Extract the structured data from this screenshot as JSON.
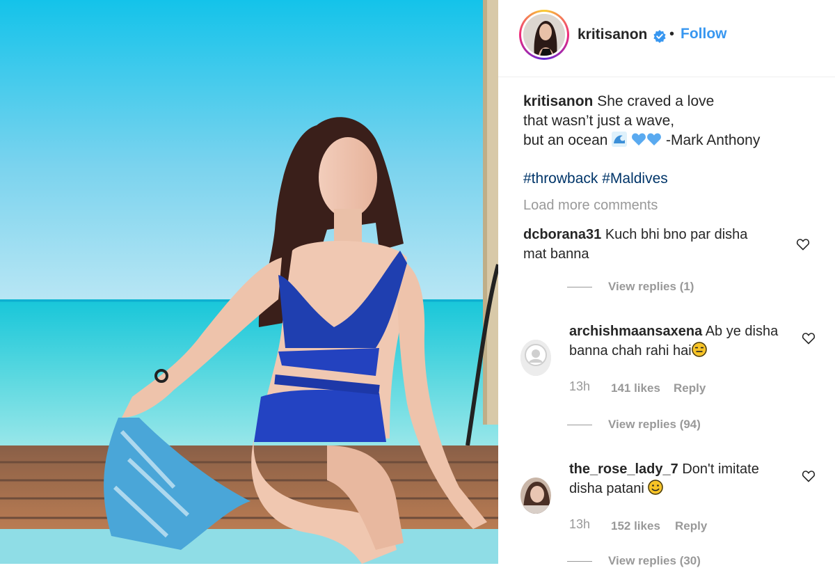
{
  "post": {
    "username": "kritisanon",
    "dot": "•",
    "follow_label": "Follow",
    "caption_user": "kritisanon",
    "caption_line1": "She craved a love",
    "caption_line2": "that wasn’t just a wave,",
    "caption_line3_a": "but an ocean",
    "caption_line3_b": "-Mark Anthony",
    "hashtag1": "#throwback",
    "hashtag2": "#Maldives",
    "load_more": "Load more comments"
  },
  "comments": [
    {
      "user": "dcborana31",
      "text_line1": "Kuch bhi bno par disha",
      "text_line2": "mat banna",
      "view_replies": "View replies (1)"
    },
    {
      "user": "archishmaansaxena",
      "text_line1": "Ab ye disha",
      "text_line2": "banna chah rahi hai",
      "time": "13h",
      "likes": "141 likes",
      "reply": "Reply",
      "view_replies": "View replies (94)"
    },
    {
      "user": "the_rose_lady_7",
      "text_line1": "Don't imitate",
      "text_line2": "disha patani",
      "time": "13h",
      "likes": "152 likes",
      "reply": "Reply",
      "view_replies": "View replies (30)"
    }
  ],
  "colors": {
    "link_blue": "#3897f0",
    "hashtag": "#003569",
    "muted": "#999999"
  }
}
